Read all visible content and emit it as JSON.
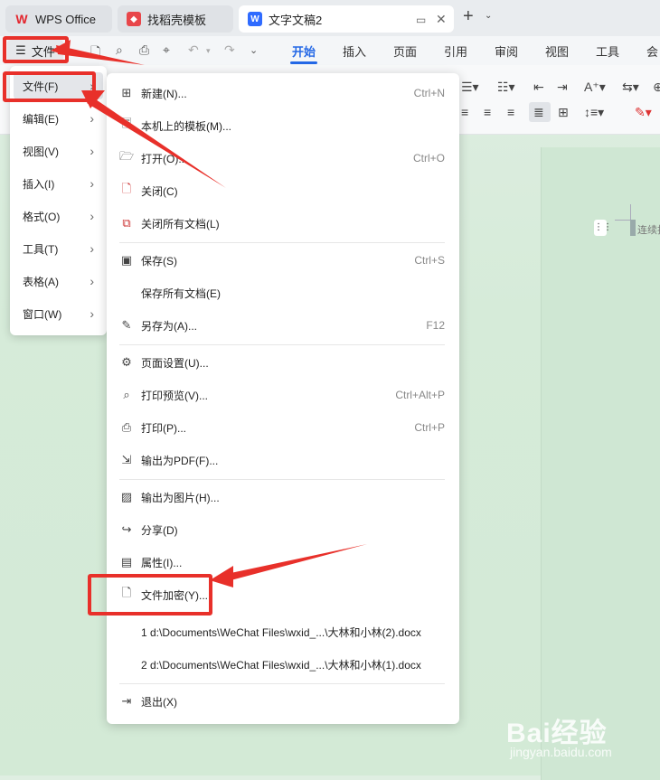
{
  "tabs": {
    "wps": "WPS Office",
    "daoke": "找稻壳模板",
    "doc": "文字文稿2",
    "wps_icon": "wps-logo-icon",
    "doc_icon": "W"
  },
  "ribbon": {
    "file_label": "文件",
    "tabs": [
      "开始",
      "插入",
      "页面",
      "引用",
      "审阅",
      "视图",
      "工具",
      "会"
    ],
    "active_tab": "开始",
    "accent": "#2468e6"
  },
  "left_menu": {
    "items": [
      {
        "label": "文件(F)",
        "selected": true
      },
      {
        "label": "编辑(E)"
      },
      {
        "label": "视图(V)"
      },
      {
        "label": "插入(I)"
      },
      {
        "label": "格式(O)"
      },
      {
        "label": "工具(T)"
      },
      {
        "label": "表格(A)"
      },
      {
        "label": "窗口(W)"
      }
    ]
  },
  "file_menu": {
    "items": [
      {
        "label": "新建(N)...",
        "shortcut": "Ctrl+N",
        "icon": "new-doc-icon"
      },
      {
        "label": "本机上的模板(M)...",
        "shortcut": "",
        "icon": "template-icon"
      },
      {
        "label": "打开(O)...",
        "shortcut": "Ctrl+O",
        "icon": "open-folder-icon"
      },
      {
        "label": "关闭(C)",
        "shortcut": "",
        "icon": "close-doc-icon"
      },
      {
        "label": "关闭所有文档(L)",
        "shortcut": "",
        "icon": "close-all-icon"
      },
      {
        "label": "保存(S)",
        "shortcut": "Ctrl+S",
        "icon": "save-icon"
      },
      {
        "label": "保存所有文档(E)",
        "shortcut": "",
        "icon": ""
      },
      {
        "label": "另存为(A)...",
        "shortcut": "F12",
        "icon": "save-as-icon"
      },
      {
        "label": "页面设置(U)...",
        "shortcut": "",
        "icon": "page-setup-icon"
      },
      {
        "label": "打印预览(V)...",
        "shortcut": "Ctrl+Alt+P",
        "icon": "print-preview-icon"
      },
      {
        "label": "打印(P)...",
        "shortcut": "Ctrl+P",
        "icon": "print-icon"
      },
      {
        "label": "输出为PDF(F)...",
        "shortcut": "",
        "icon": "export-pdf-icon"
      },
      {
        "label": "输出为图片(H)...",
        "shortcut": "",
        "icon": "export-image-icon"
      },
      {
        "label": "分享(D)",
        "shortcut": "",
        "icon": "share-icon"
      },
      {
        "label": "属性(I)...",
        "shortcut": "",
        "icon": "properties-icon"
      },
      {
        "label": "文件加密(Y)...",
        "shortcut": "",
        "icon": "encrypt-icon"
      },
      {
        "label": "1 d:\\Documents\\WeChat Files\\wxid_...\\大林和小林(2).docx",
        "shortcut": "",
        "icon": ""
      },
      {
        "label": "2 d:\\Documents\\WeChat Files\\wxid_...\\大林和小林(1).docx",
        "shortcut": "",
        "icon": ""
      },
      {
        "label": "退出(X)",
        "shortcut": "",
        "icon": "exit-icon"
      }
    ]
  },
  "document": {
    "hint": "连续找"
  },
  "watermark": {
    "logo": "Bai经验",
    "url": "jingyan.baidu.com"
  },
  "annotation_color": "#e8302a"
}
